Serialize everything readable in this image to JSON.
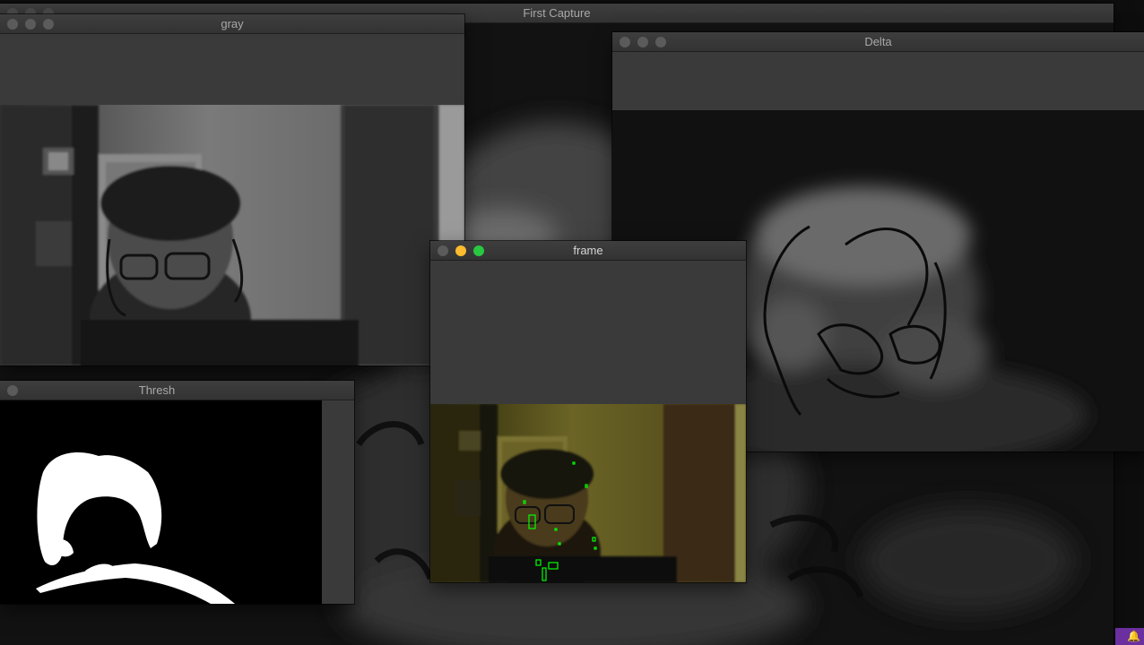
{
  "windows": {
    "first_capture": {
      "title": "First Capture"
    },
    "gray": {
      "title": "gray"
    },
    "delta": {
      "title": "Delta"
    },
    "frame": {
      "title": "frame"
    },
    "thresh": {
      "title": "Thresh"
    }
  },
  "colors": {
    "traffic_close_active": "#ff5f57",
    "traffic_min_active": "#febc2e",
    "traffic_max_active": "#28c840",
    "traffic_inactive": "#5b5b5b",
    "detection_box": "#00ff00",
    "notification_badge": "#6b2fa0"
  }
}
